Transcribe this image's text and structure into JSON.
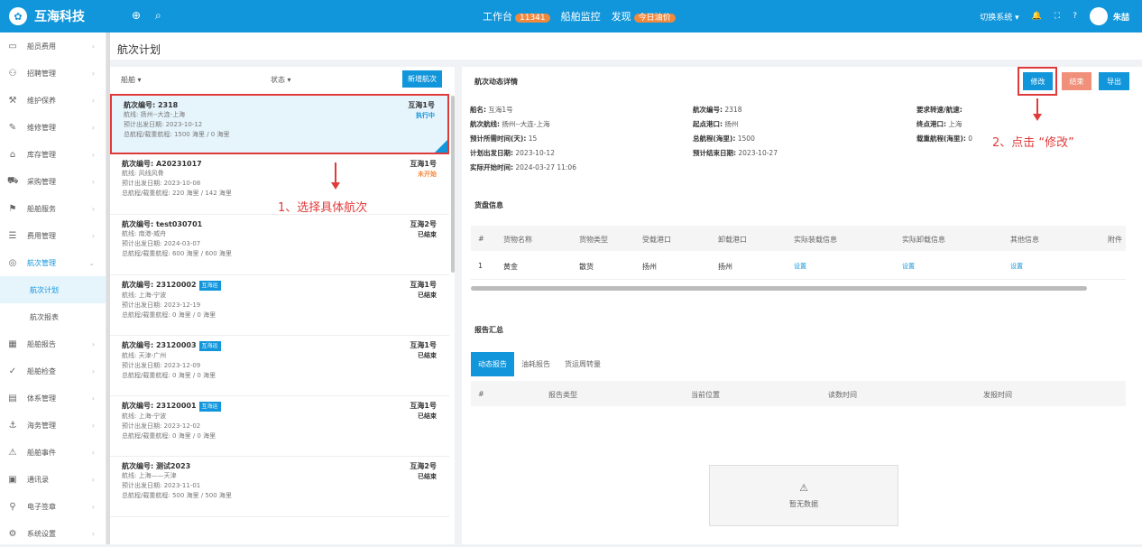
{
  "app": {
    "name": "互海科技",
    "switch": "切换系统",
    "user": "朱喆"
  },
  "topnav": {
    "workbench": "工作台",
    "workbench_count": "11341",
    "monitor": "船舶监控",
    "discover": "发现",
    "discover_badge": "今日油价"
  },
  "breadcrumb": "航次计划",
  "sidebar": {
    "items": [
      {
        "label": "船员费用",
        "icon": "card-icon"
      },
      {
        "label": "招聘管理",
        "icon": "user-icon"
      },
      {
        "label": "维护保养",
        "icon": "tool-icon"
      },
      {
        "label": "维修管理",
        "icon": "wrench-icon"
      },
      {
        "label": "库存管理",
        "icon": "home-icon"
      },
      {
        "label": "采购管理",
        "icon": "cart-icon"
      },
      {
        "label": "船舶服务",
        "icon": "service-icon"
      },
      {
        "label": "费用管理",
        "icon": "database-icon"
      },
      {
        "label": "航次管理",
        "icon": "globe-icon"
      },
      {
        "label": "航次计划",
        "icon": ""
      },
      {
        "label": "航次报表",
        "icon": ""
      },
      {
        "label": "船舶报告",
        "icon": "calendar-icon"
      },
      {
        "label": "船舶检查",
        "icon": "check-icon"
      },
      {
        "label": "体系管理",
        "icon": "doc-icon"
      },
      {
        "label": "海务管理",
        "icon": "anchor-icon"
      },
      {
        "label": "船舶事件",
        "icon": "warning-icon"
      },
      {
        "label": "通讯录",
        "icon": "book-icon"
      },
      {
        "label": "电子签章",
        "icon": "seal-icon"
      },
      {
        "label": "系统设置",
        "icon": "gear-icon"
      }
    ]
  },
  "list": {
    "filter_ship": "船舶 ▾",
    "filter_status": "状态 ▾",
    "add_label": "新增航次",
    "voyages": [
      {
        "no": "航次编号: 2318",
        "ship": "互海1号",
        "status": "执行中",
        "route": "航线: 扬州--大连-上海",
        "date": "预计出发日期: 2023-10-12",
        "range": "总航程/载重航程: 1500 海里 / 0 海里",
        "tag": ""
      },
      {
        "no": "航次编号: A20231017",
        "ship": "互海1号",
        "status": "未开始",
        "route": "航线: 风线风骨",
        "date": "预计出发日期: 2023-10-08",
        "range": "总航程/载重航程: 220 海里 / 142 海里",
        "tag": ""
      },
      {
        "no": "航次编号: test030701",
        "ship": "互海2号",
        "status": "已结束",
        "route": "航线: 南港-威舟",
        "date": "预计出发日期: 2024-03-07",
        "range": "总航程/载重航程: 600 海里 / 600 海里",
        "tag": ""
      },
      {
        "no": "航次编号: 23120002",
        "ship": "互海1号",
        "status": "已结束",
        "route": "航线: 上海-宁波",
        "date": "预计出发日期: 2023-12-19",
        "range": "总航程/载重航程: 0 海里 / 0 海里",
        "tag": "互海运"
      },
      {
        "no": "航次编号: 23120003",
        "ship": "互海1号",
        "status": "已结束",
        "route": "航线: 天津-广州",
        "date": "预计出发日期: 2023-12-09",
        "range": "总航程/载重航程: 0 海里 / 0 海里",
        "tag": "互海运"
      },
      {
        "no": "航次编号: 23120001",
        "ship": "互海1号",
        "status": "已结束",
        "route": "航线: 上海-宁波",
        "date": "预计出发日期: 2023-12-02",
        "range": "总航程/载重航程: 0 海里 / 0 海里",
        "tag": "互海运"
      },
      {
        "no": "航次编号: 测试2023",
        "ship": "互海2号",
        "status": "已结束",
        "route": "航线: 上海——天津",
        "date": "预计出发日期: 2023-11-01",
        "range": "总航程/载重航程: 500 海里 / 500 海里",
        "tag": ""
      }
    ]
  },
  "annotations": {
    "step1": "1、选择具体航次",
    "step2": "2、点击 “修改”"
  },
  "detail": {
    "title": "航次动态详情",
    "edit": "修改",
    "end": "结束",
    "export": "导出",
    "ship": "船名:",
    "ship_v": "互海1号",
    "route": "航次航线:",
    "route_v": "扬州--大连-上海",
    "days": "预计所需时间(天):",
    "days_v": "15",
    "plan_date": "计划出发日期:",
    "plan_date_v": "2023-10-12",
    "start": "实际开始时间:",
    "start_v": "2024-03-27 11:06",
    "no": "航次编号:",
    "no_v": "2318",
    "from": "起点港口:",
    "from_v": "扬州",
    "total": "总航程(海里):",
    "total_v": "1500",
    "end_date": "预计结束日期:",
    "end_date_v": "2023-10-27",
    "speed": "要求转速/航速:",
    "speed_v": "",
    "to": "终点港口:",
    "to_v": "上海",
    "load": "载重航程(海里):",
    "load_v": "0",
    "cargo_title": "货盘信息",
    "cargo_cols": [
      "#",
      "货物名称",
      "货物类型",
      "受载港口",
      "卸载港口",
      "实际装载信息",
      "实际卸载信息",
      "其他信息",
      "附件"
    ],
    "cargo_row": [
      "1",
      "黄金",
      "散货",
      "扬州",
      "扬州",
      "设置",
      "设置",
      "设置",
      ""
    ],
    "report_title": "报告汇总",
    "tabs": [
      "动态报告",
      "油耗报告",
      "货运周转量"
    ],
    "report_cols": [
      "#",
      "报告类型",
      "当前位置",
      "读数时间",
      "发报时间"
    ],
    "empty": "暂无数据"
  }
}
